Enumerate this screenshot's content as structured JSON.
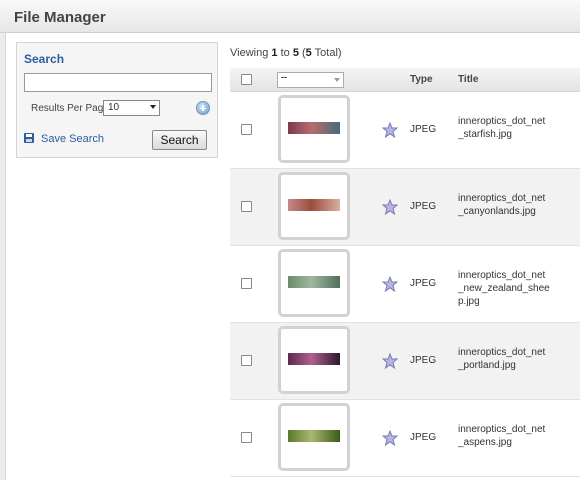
{
  "header": {
    "title": "File Manager"
  },
  "search": {
    "title": "Search",
    "input_value": "",
    "rpp_label": "Results Per Page",
    "rpp_value": "10",
    "save_label": "Save Search",
    "button_label": "Search"
  },
  "viewing": {
    "prefix": "Viewing ",
    "from": "1",
    "to_word": " to ",
    "to": "5",
    "open": " (",
    "total": "5",
    "close": " Total)"
  },
  "grid": {
    "header": {
      "select_value": "--",
      "type_label": "Type",
      "title_label": "Title"
    },
    "rows": [
      {
        "type": "JPEG",
        "title_lines": [
          "inneroptics_dot_net",
          "_starfish.jpg"
        ],
        "thumb_colors": [
          "#7a3a4a",
          "#b86c6c",
          "#4a6a7a"
        ]
      },
      {
        "type": "JPEG",
        "title_lines": [
          "inneroptics_dot_net",
          "_canyonlands.jpg"
        ],
        "thumb_colors": [
          "#c48a8a",
          "#9a4e3e",
          "#d9b0a0"
        ]
      },
      {
        "type": "JPEG",
        "title_lines": [
          "inneroptics_dot_net",
          "_new_zealand_shee",
          "p.jpg"
        ],
        "thumb_colors": [
          "#6a8a6a",
          "#9fb8a2",
          "#4f6f5a"
        ]
      },
      {
        "type": "JPEG",
        "title_lines": [
          "inneroptics_dot_net",
          "_portland.jpg"
        ],
        "thumb_colors": [
          "#5a2a4a",
          "#b06090",
          "#2a1a2a"
        ]
      },
      {
        "type": "JPEG",
        "title_lines": [
          "inneroptics_dot_net",
          "_aspens.jpg"
        ],
        "thumb_colors": [
          "#5a7a2a",
          "#a8b870",
          "#3a5a1a"
        ]
      }
    ]
  },
  "icons": {
    "star": "star-icon",
    "add": "add-circle-icon",
    "save": "floppy-disk-icon"
  },
  "colors": {
    "link": "#2a5ea0",
    "row_alt": "#f2f2f2",
    "star": "#8a88c8"
  }
}
